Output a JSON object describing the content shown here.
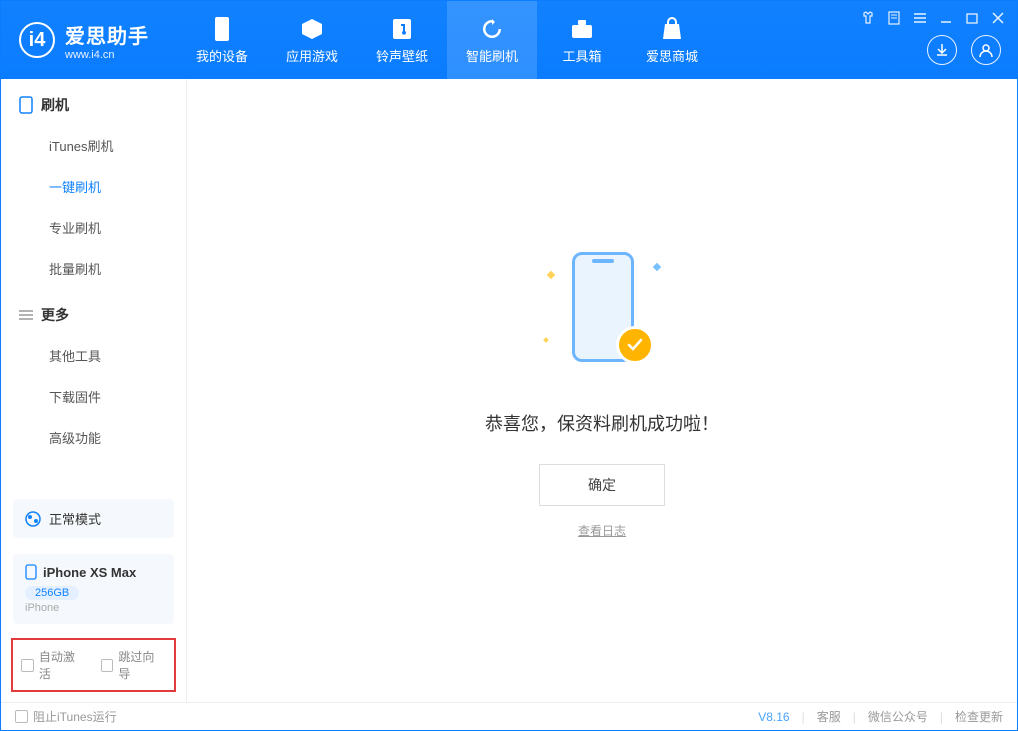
{
  "app": {
    "title": "爱思助手",
    "subtitle": "www.i4.cn"
  },
  "nav": {
    "items": [
      {
        "label": "我的设备"
      },
      {
        "label": "应用游戏"
      },
      {
        "label": "铃声壁纸"
      },
      {
        "label": "智能刷机"
      },
      {
        "label": "工具箱"
      },
      {
        "label": "爱思商城"
      }
    ]
  },
  "sidebar": {
    "section1_title": "刷机",
    "items1": [
      {
        "label": "iTunes刷机"
      },
      {
        "label": "一键刷机"
      },
      {
        "label": "专业刷机"
      },
      {
        "label": "批量刷机"
      }
    ],
    "section2_title": "更多",
    "items2": [
      {
        "label": "其他工具"
      },
      {
        "label": "下载固件"
      },
      {
        "label": "高级功能"
      }
    ],
    "mode_label": "正常模式",
    "device": {
      "name": "iPhone XS Max",
      "storage": "256GB",
      "type": "iPhone"
    },
    "opt_auto_activate": "自动激活",
    "opt_skip_guide": "跳过向导"
  },
  "main": {
    "message": "恭喜您，保资料刷机成功啦！",
    "ok_label": "确定",
    "log_link": "查看日志"
  },
  "statusbar": {
    "block_itunes": "阻止iTunes运行",
    "version": "V8.16",
    "links": [
      "客服",
      "微信公众号",
      "检查更新"
    ]
  }
}
